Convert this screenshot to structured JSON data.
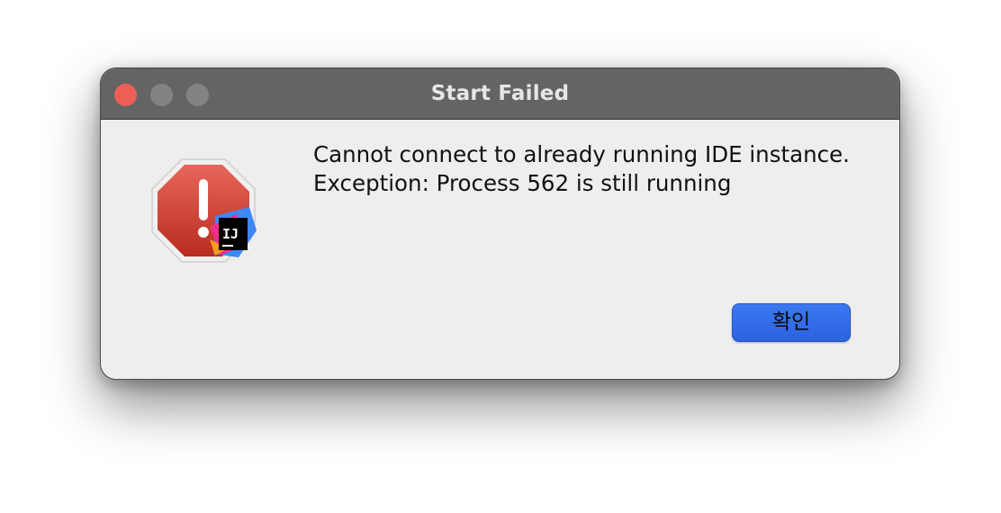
{
  "window": {
    "title": "Start Failed",
    "controls": {
      "close_color": "#ec5f55",
      "inactive_color": "#838383"
    }
  },
  "icon": {
    "name": "intellij-idea-error-icon",
    "badge_text": "IJ"
  },
  "message": {
    "line1": "Cannot connect to already running IDE instance.",
    "line2": "Exception: Process 562 is still running"
  },
  "buttons": {
    "confirm_label": "확인",
    "confirm_color": "#2f6ae6"
  }
}
